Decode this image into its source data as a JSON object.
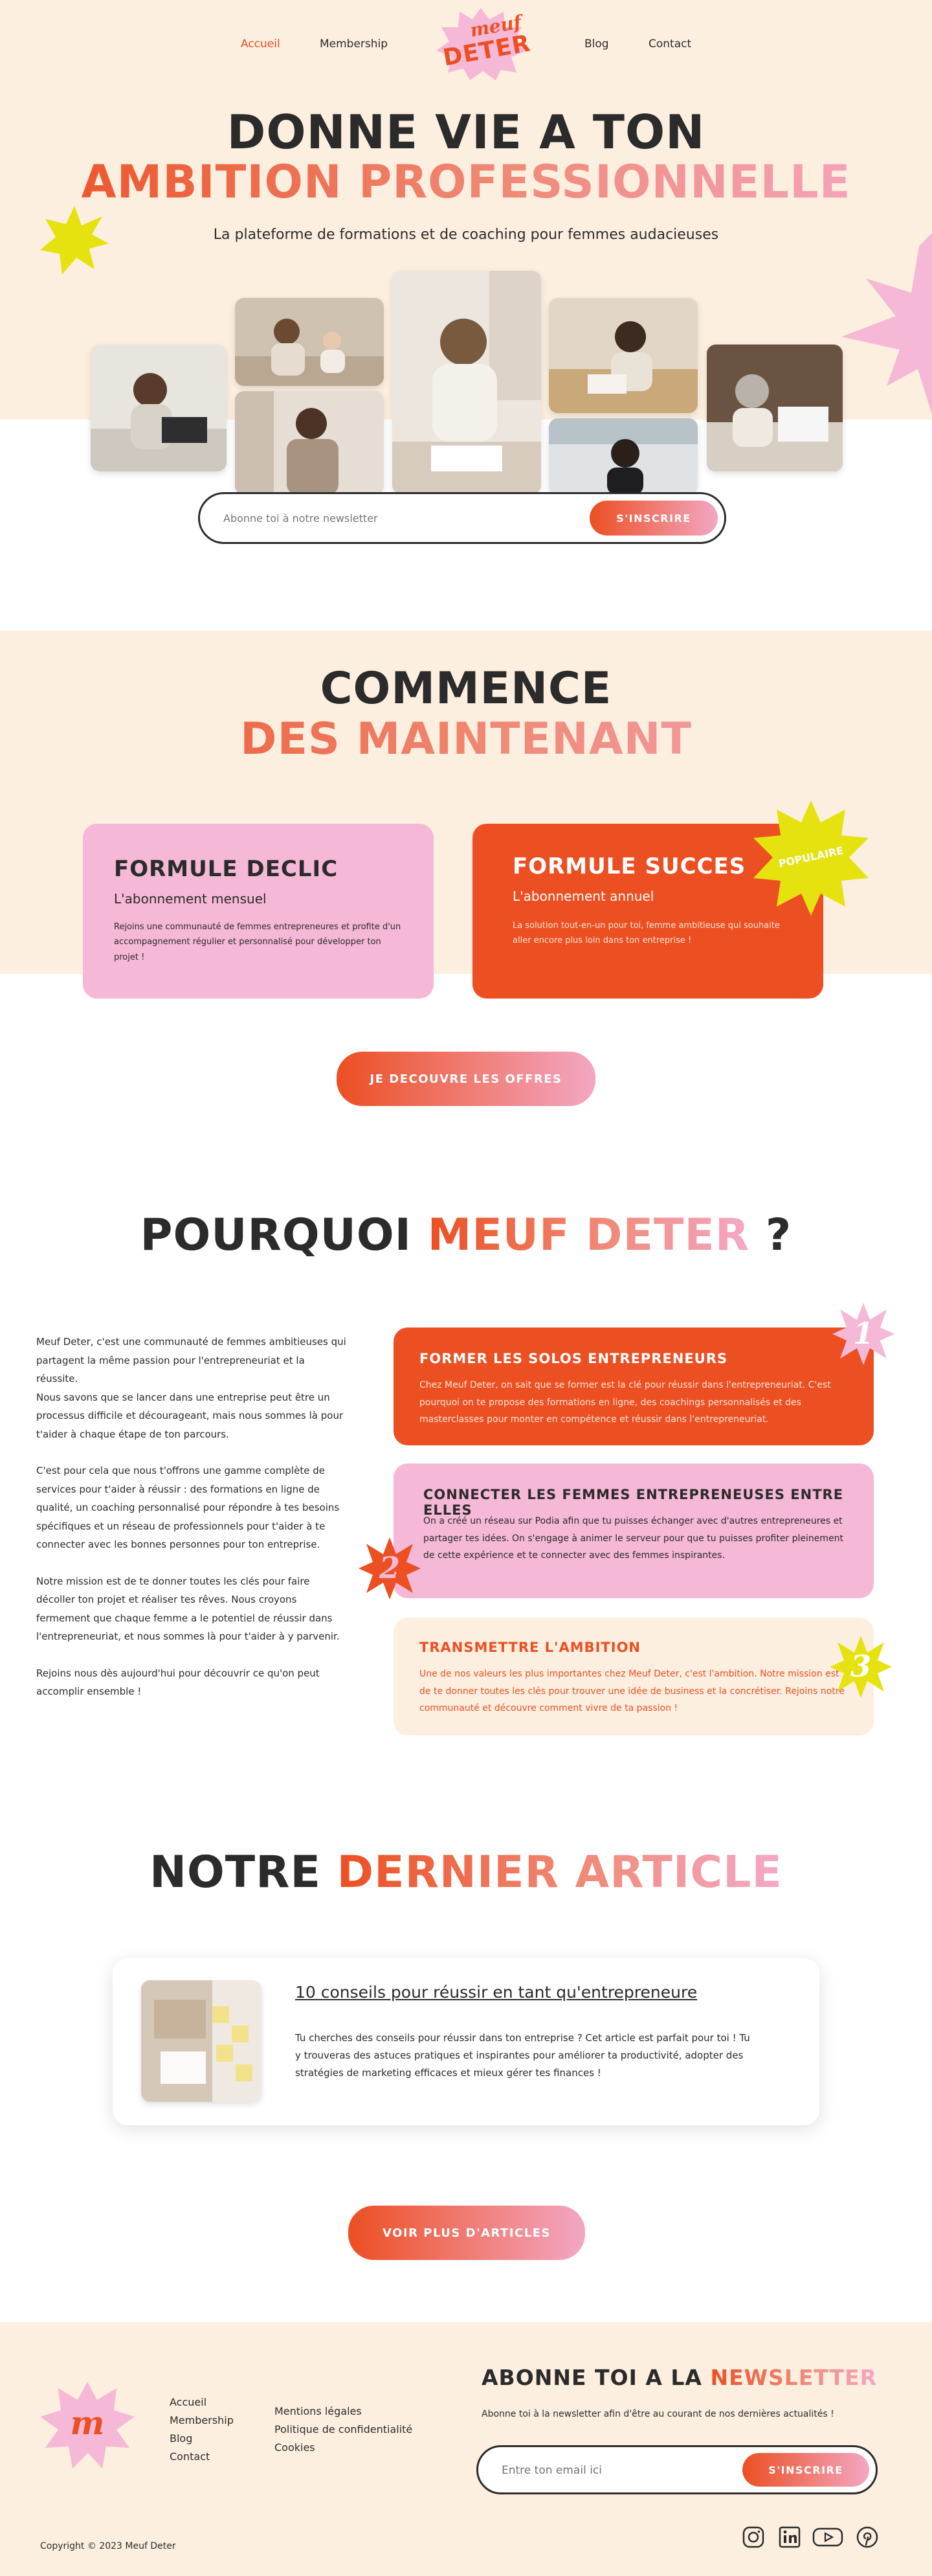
{
  "nav": {
    "items": [
      "Accueil",
      "Membership",
      "Blog",
      "Contact"
    ],
    "logo_line1": "meuf",
    "logo_line2": "DETER"
  },
  "hero": {
    "title_line1": "DONNE VIE A TON",
    "title_line2": "AMBITION PROFESSIONNELLE",
    "subtitle": "La plateforme de formations et de coaching pour femmes audacieuses",
    "newsletter_placeholder": "Abonne toi à notre newsletter",
    "newsletter_button": "S'INSCRIRE"
  },
  "start": {
    "title_line1": "COMMENCE",
    "title_line2": "DES MAINTENANT",
    "card1": {
      "title": "FORMULE DECLIC",
      "subtitle": "L'abonnement mensuel",
      "text": "Rejoins une communauté de femmes entrepreneures et profite d'un accompagnement régulier et personnalisé pour développer ton projet !"
    },
    "card2": {
      "title": "FORMULE SUCCES",
      "subtitle": "L'abonnement annuel",
      "text": "La solution tout-en-un pour toi, femme ambitieuse qui souhaite aller encore plus loin dans ton entreprise !",
      "badge": "POPULAIRE"
    },
    "cta": "JE DECOUVRE LES OFFRES"
  },
  "why": {
    "title_part1": "POURQUOI",
    "title_part2": "MEUF DETER",
    "title_part3": "?",
    "para1": "Meuf Deter, c'est une communauté de femmes ambitieuses qui partagent la même passion pour l'entrepreneuriat et la réussite.",
    "para2": "Nous savons que se lancer dans une entreprise peut être un processus difficile et décourageant, mais nous sommes là pour t'aider à chaque étape de ton parcours.",
    "para3": "C'est pour cela que nous t'offrons une gamme complète de services pour t'aider à réussir : des formations en ligne de qualité, un coaching personnalisé pour répondre à tes besoins spécifiques et un réseau de professionnels pour t'aider à te connecter avec les bonnes personnes pour ton entreprise.",
    "para4": "Notre mission est de te donner toutes les clés pour faire décoller ton projet et réaliser tes rêves. Nous croyons fermement que chaque femme a le potentiel de réussir dans l'entrepreneuriat, et nous sommes là pour t'aider à y parvenir.",
    "para5": "Rejoins nous dès aujourd'hui pour découvrir ce qu'on peut accomplir ensemble !",
    "box1": {
      "number": "1",
      "title": "FORMER LES SOLOS ENTREPRENEURS",
      "text": "Chez Meuf Deter, on sait que se former est la clé pour réussir dans l'entrepreneuriat. C'est pourquoi on te propose des formations en ligne, des coachings personnalisés et des masterclasses pour monter en compétence et réussir dans l'entrepreneuriat."
    },
    "box2": {
      "number": "2",
      "title": "CONNECTER LES FEMMES ENTREPRENEUSES ENTRE ELLES",
      "text": "On a créé un réseau sur Podia afin que tu puisses échanger avec d'autres entrepreneures et partager tes idées. On s'engage à animer le serveur pour que tu puisses profiter pleinement de cette expérience et te connecter avec des femmes inspirantes."
    },
    "box3": {
      "number": "3",
      "title": "TRANSMETTRE L'AMBITION",
      "text": "Une de nos valeurs les plus importantes chez Meuf Deter, c'est l'ambition. Notre mission est de te donner toutes les clés pour trouver une idée de business et la concrétiser. Rejoins notre communauté et découvre comment vivre de ta passion !"
    }
  },
  "article": {
    "title_part1": "NOTRE",
    "title_part2": "DERNIER ARTICLE",
    "post_title": "10 conseils pour réussir en tant qu'entrepreneure",
    "post_text": "Tu cherches des conseils pour réussir dans ton entreprise ? Cet article est parfait pour toi ! Tu y trouveras des astuces pratiques et inspirantes pour améliorer ta productivité, adopter des stratégies de marketing efficaces et mieux gérer tes finances !",
    "cta": "VOIR PLUS D'ARTICLES"
  },
  "footer": {
    "logo_letter": "m",
    "links1": [
      "Accueil",
      "Membership",
      "Blog",
      "Contact"
    ],
    "links2": [
      "Mentions légales",
      "Politique de confidentialité",
      "Cookies"
    ],
    "newsletter_title_part1": "ABONNE TOI A LA",
    "newsletter_title_part2": "NEWSLETTER",
    "newsletter_text": "Abonne toi à la newsletter afin d'être au courant de nos dernières actualités !",
    "email_placeholder": "Entre ton email ici",
    "button": "S'INSCRIRE",
    "copyright": "Copyright © 2023 Meuf Deter",
    "socials": [
      "instagram-icon",
      "linkedin-icon",
      "youtube-icon",
      "pinterest-icon"
    ]
  },
  "colors": {
    "orange": "#ec4f22",
    "pink": "#f5b8d6",
    "cream": "#fdefe0",
    "yellow": "#e6e210",
    "dark": "#2b2b2b"
  }
}
